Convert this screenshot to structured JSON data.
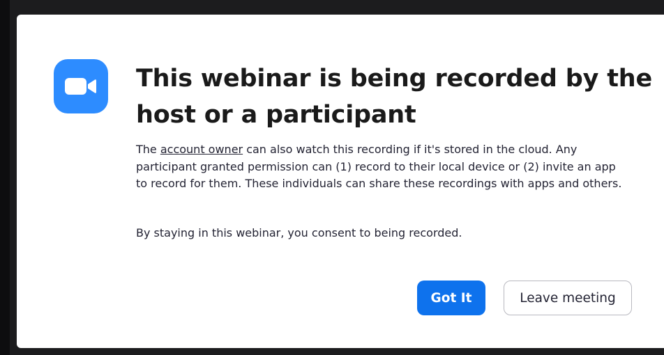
{
  "dialog": {
    "app_icon": "video-camera-icon",
    "title": "This webinar is being recorded by the host or a participant",
    "description": {
      "prefix": "The ",
      "link_text": "account owner",
      "suffix": " can also watch this recording if it's stored in the cloud. Any participant granted permission can (1) record to their local device or (2) invite an app to record for them. These individuals can share these recordings with apps and others."
    },
    "consent_text": "By staying in this webinar, you consent to being recorded.",
    "buttons": {
      "primary_label": "Got It",
      "secondary_label": "Leave meeting"
    }
  },
  "colors": {
    "accent": "#0e72ed",
    "icon_background": "#2d8cff",
    "text": "#232333",
    "backdrop": "#1c1c1e"
  }
}
